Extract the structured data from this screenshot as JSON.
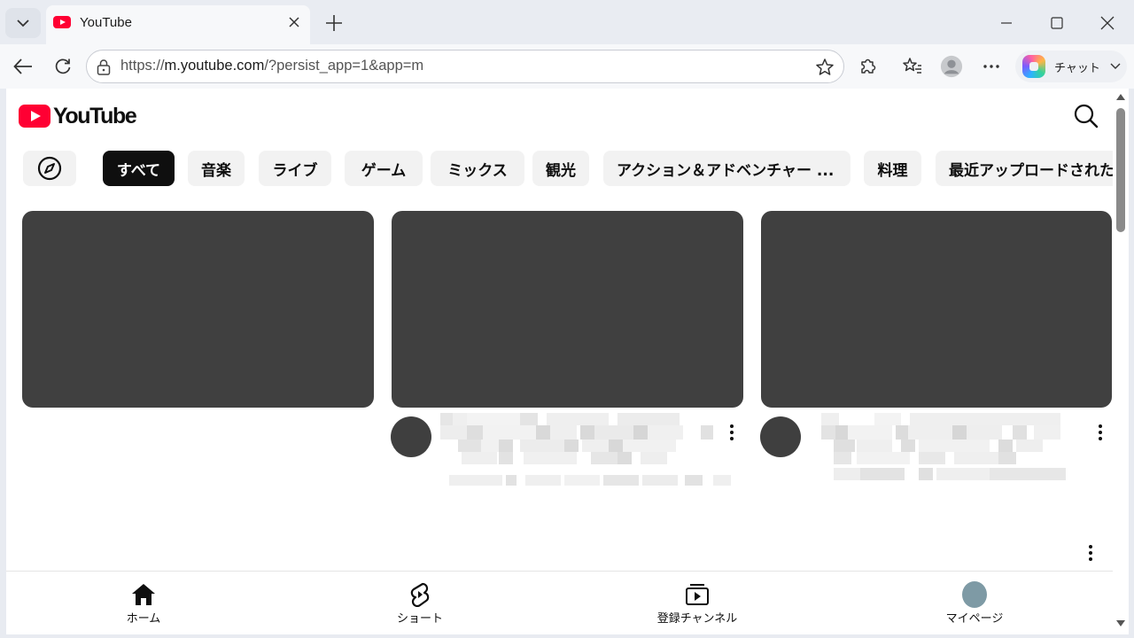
{
  "browser": {
    "tab": {
      "title": "YouTube"
    },
    "url": {
      "prefix": "https://",
      "host": "m.youtube.com",
      "path": "/?persist_app=1&app=m"
    },
    "copilot_label": "チャット"
  },
  "youtube": {
    "logo_text": "YouTube",
    "chips": [
      "すべて",
      "音楽",
      "ライブ",
      "ゲーム",
      "ミックス",
      "観光",
      "アクション＆アドベンチャー ...",
      "料理",
      "最近アップロードされた"
    ],
    "active_chip_index": 0,
    "bottom_nav": [
      {
        "label": "ホーム",
        "icon": "home-icon"
      },
      {
        "label": "ショート",
        "icon": "shorts-icon"
      },
      {
        "label": "登録チャンネル",
        "icon": "subscriptions-icon"
      },
      {
        "label": "マイページ",
        "icon": "avatar"
      }
    ]
  },
  "colors": {
    "youtube_red": "#ff0033",
    "thumbnail_placeholder": "#404040",
    "chip_bg": "#f2f2f2",
    "chip_active_bg": "#0f0f0f"
  }
}
